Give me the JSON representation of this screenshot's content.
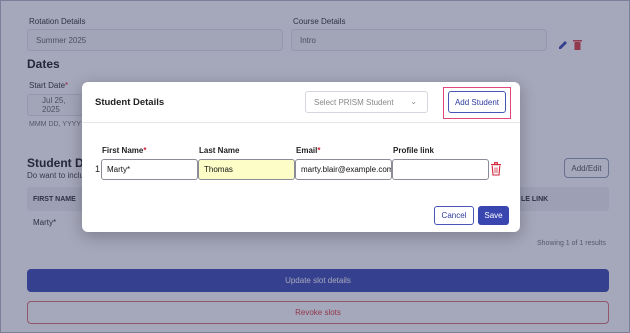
{
  "background": {
    "rotation_label": "Rotation Details",
    "rotation_value": "Summer 2025",
    "course_label": "Course Details",
    "course_value": "Intro",
    "dates_heading": "Dates",
    "start_date_label": "Start Date",
    "start_date_required": "*",
    "start_date_value": "Jul 25, 2025",
    "date_format_hint": "MMM DD, YYYY",
    "student_details_heading": "Student Det",
    "student_details_sub": "Do want to inclu",
    "add_edit_button": "Add/Edit",
    "table_header_first": "FIRST NAME",
    "table_header_profile": "LE LINK",
    "table_row_first": "Marty*",
    "showing_text": "Showing 1 of 1 results",
    "update_button": "Update slot details",
    "revoke_button": "Revoke slots"
  },
  "modal": {
    "title": "Student Details",
    "select_placeholder": "Select PRISM Student",
    "add_student_button": "Add Student",
    "columns": {
      "first_name": "First Name",
      "last_name": "Last Name",
      "email": "Email",
      "profile_link": "Profile link",
      "required_marker": "*"
    },
    "row": {
      "index": "1",
      "first_name": "Marty*",
      "last_name": "Thomas",
      "email": "marty.blair@example.com",
      "profile_link": ""
    },
    "cancel_button": "Cancel",
    "save_button": "Save"
  },
  "colors": {
    "primary": "#3946b0",
    "highlight": "#e0457b",
    "danger": "#d0263a",
    "field_highlight": "#fdfdc8"
  },
  "icons": [
    "edit-icon",
    "delete-icon",
    "chevron-down-icon",
    "trash-icon"
  ]
}
